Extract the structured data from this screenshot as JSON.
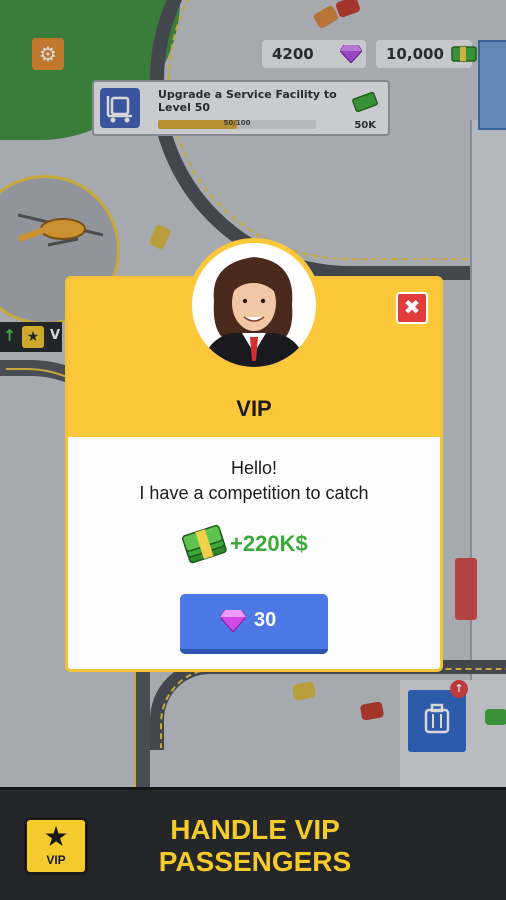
{
  "resources": {
    "gems": "4200",
    "cash": "10,000"
  },
  "task": {
    "text": "Upgrade a Service Facility to Level 50",
    "progress_label": "50/100",
    "progress_fraction": 0.5,
    "reward": "50K"
  },
  "dialog": {
    "title": "VIP",
    "message_line1": "Hello!",
    "message_line2": "I have a competition to catch",
    "reward": "+220K$",
    "button_cost": "30",
    "close_symbol": "✖"
  },
  "side_tab": {
    "arrow": "↑",
    "label": "V"
  },
  "banner": {
    "badge_label": "VIP",
    "line1": "HANDLE VIP",
    "line2": "PASSENGERS"
  },
  "colors": {
    "dialog_header": "#fdc73a",
    "button": "#4d79e6",
    "reward_text": "#3da83a",
    "close": "#e23b3b",
    "banner_text": "#f5cb2c"
  },
  "icons": [
    "gear-icon",
    "gem-icon",
    "cash-icon",
    "luggage-cart-icon",
    "star-icon",
    "close-icon",
    "helicopter-icon",
    "luggage-icon"
  ]
}
